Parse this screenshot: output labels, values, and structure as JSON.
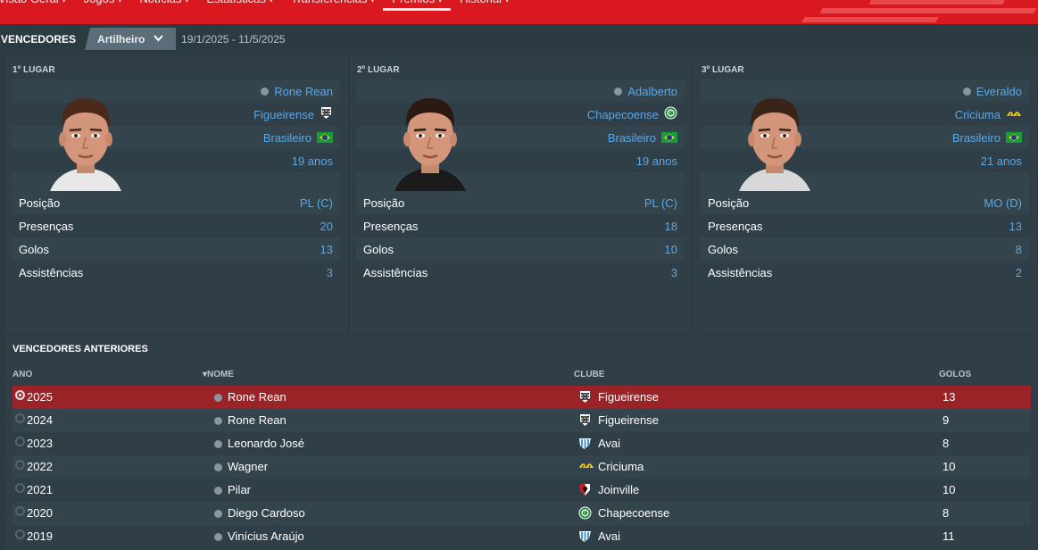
{
  "nav": {
    "tabs": [
      {
        "label": "Visão Geral",
        "caret": "▾"
      },
      {
        "label": "Jogos",
        "caret": "▾"
      },
      {
        "label": "Notícias",
        "caret": "▾"
      },
      {
        "label": "Estatísticas",
        "caret": "▾"
      },
      {
        "label": "Transferências",
        "caret": "▾"
      },
      {
        "label": "Prémios",
        "caret": "▾"
      },
      {
        "label": "Histórial",
        "caret": "▾"
      }
    ],
    "active_index": 5
  },
  "header": {
    "title": "VENCEDORES",
    "dropdown_value": "Artilheiro",
    "date_range": "19/1/2025 - 11/5/2025"
  },
  "winners": [
    {
      "place": "1º LUGAR",
      "name": "Rone Rean",
      "club": "Figueirense",
      "club_icon": "figueirense-crest-icon",
      "nationality": "Brasileiro",
      "age": "19 anos",
      "stats": [
        {
          "label": "Posição",
          "value": "PL (C)"
        },
        {
          "label": "Presenças",
          "value": "20"
        },
        {
          "label": "Golos",
          "value": "13"
        },
        {
          "label": "Assistências",
          "value": "3"
        }
      ]
    },
    {
      "place": "2º LUGAR",
      "name": "Adalberto",
      "club": "Chapecoense",
      "club_icon": "chapecoense-crest-icon",
      "nationality": "Brasileiro",
      "age": "19 anos",
      "stats": [
        {
          "label": "Posição",
          "value": "PL (C)"
        },
        {
          "label": "Presenças",
          "value": "18"
        },
        {
          "label": "Golos",
          "value": "10"
        },
        {
          "label": "Assistências",
          "value": "3"
        }
      ]
    },
    {
      "place": "3º LUGAR",
      "name": "Everaldo",
      "club": "Criciuma",
      "club_icon": "criciuma-crest-icon",
      "nationality": "Brasileiro",
      "age": "21 anos",
      "stats": [
        {
          "label": "Posição",
          "value": "MO (D)"
        },
        {
          "label": "Presenças",
          "value": "13"
        },
        {
          "label": "Golos",
          "value": "8"
        },
        {
          "label": "Assistências",
          "value": "2"
        }
      ]
    }
  ],
  "previous": {
    "title": "VENCEDORES ANTERIORES",
    "columns": {
      "year": "ANO",
      "name": "NOME",
      "club": "CLUBE",
      "goals": "GOLOS"
    },
    "sort_indicator": "▾",
    "rows": [
      {
        "year": "2025",
        "name": "Rone Rean",
        "club": "Figueirense",
        "club_icon": "figueirense",
        "goals": "13",
        "selected": true
      },
      {
        "year": "2024",
        "name": "Rone Rean",
        "club": "Figueirense",
        "club_icon": "figueirense",
        "goals": "9"
      },
      {
        "year": "2023",
        "name": "Leonardo José",
        "club": "Avai",
        "club_icon": "avai",
        "goals": "8"
      },
      {
        "year": "2022",
        "name": "Wagner",
        "club": "Criciuma",
        "club_icon": "criciuma",
        "goals": "10"
      },
      {
        "year": "2021",
        "name": "Pilar",
        "club": "Joinville",
        "club_icon": "joinville",
        "goals": "10"
      },
      {
        "year": "2020",
        "name": "Diego Cardoso",
        "club": "Chapecoense",
        "club_icon": "chapecoense",
        "goals": "8"
      },
      {
        "year": "2019",
        "name": "Vinícius Araújo",
        "club": "Avai",
        "club_icon": "avai",
        "goals": "11"
      }
    ]
  },
  "colors": {
    "accent_red": "#d9191f",
    "selected_row": "#9a2327",
    "link_blue": "#5ba8e6"
  }
}
